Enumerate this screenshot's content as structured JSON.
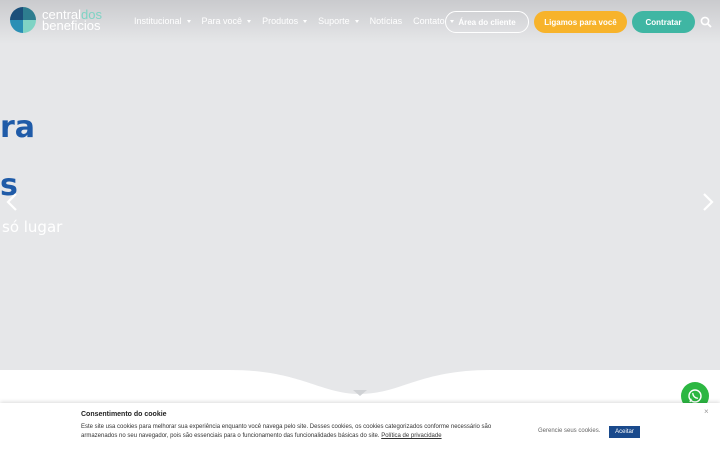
{
  "header": {
    "logo": {
      "word1": "central",
      "word2": "dos",
      "word3": "beneficios"
    },
    "nav": [
      {
        "label": "Institucional",
        "dropdown": true
      },
      {
        "label": "Para você",
        "dropdown": true
      },
      {
        "label": "Produtos",
        "dropdown": true
      },
      {
        "label": "Suporte",
        "dropdown": true
      },
      {
        "label": "Notícias",
        "dropdown": false
      },
      {
        "label": "Contato",
        "dropdown": true
      }
    ],
    "buttons": {
      "area_cliente": "Área do cliente",
      "ligamos": "Ligamos para você",
      "contratar": "Contratar"
    },
    "search_icon": "search-icon"
  },
  "hero": {
    "headline_1": "ra",
    "headline_2": "s",
    "sub": "só lugar",
    "prev_icon": "chevron-left-icon",
    "next_icon": "chevron-right-icon"
  },
  "whatsapp": {
    "icon": "whatsapp-icon"
  },
  "cookie": {
    "title": "Consentimento do cookie",
    "text": "Este site usa cookies para melhorar sua experiência enquanto você navega pelo site. Desses cookies, os cookies categorizados conforme necessário são armazenados no seu navegador, pois são essenciais para o funcionamento das funcionalidades básicas do site.",
    "policy_link": "Política de privacidade",
    "manage": "Gerencie seus cookies.",
    "accept": "Aceitar",
    "close": "×"
  },
  "colors": {
    "brand_blue": "#1f5ba8",
    "teal": "#3fb6a3",
    "orange": "#f7b32b",
    "hero_bg": "#e6e7e9",
    "whatsapp": "#2cb742",
    "accept_button": "#1a4a8c"
  }
}
